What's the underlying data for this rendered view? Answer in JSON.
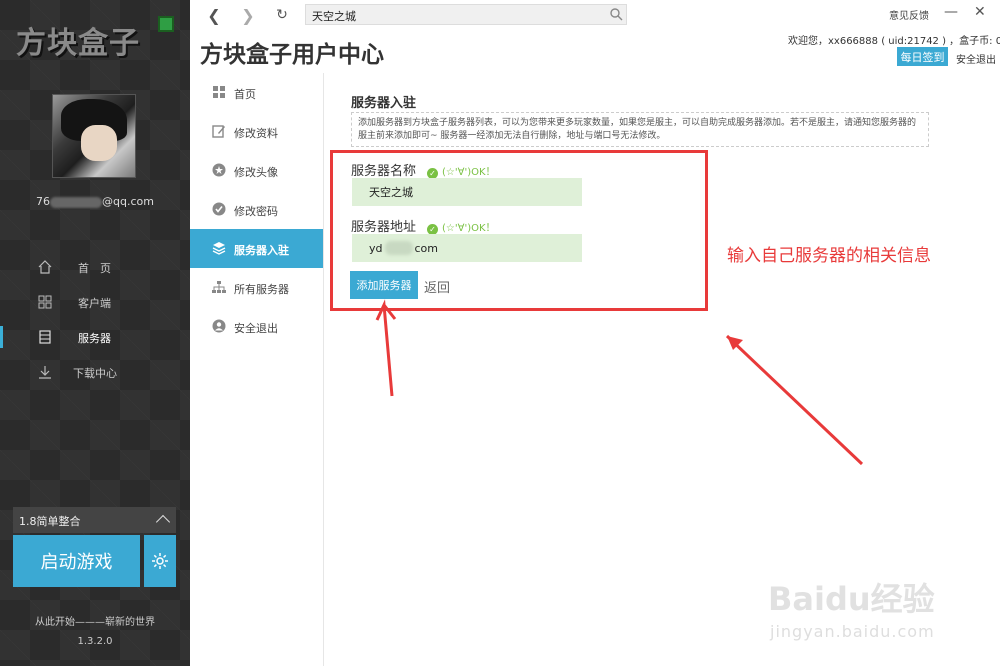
{
  "sidebar": {
    "logo": "方块盒子",
    "email_prefix": "76",
    "email_suffix": "@qq.com",
    "nav": [
      {
        "label": "首　页",
        "icon": "home-icon"
      },
      {
        "label": "客户端",
        "icon": "grid-icon"
      },
      {
        "label": "服务器",
        "icon": "server-icon"
      },
      {
        "label": "下载中心",
        "icon": "download-icon"
      }
    ],
    "version_select": "1.8简单整合",
    "launch_label": "启动游戏",
    "tagline": "从此开始———崭新的世界",
    "version": "1.3.2.0"
  },
  "topbar": {
    "address": "天空之城",
    "feedback": "意见反馈",
    "minimize": "—",
    "close": "✕"
  },
  "header": {
    "title": "方块盒子用户中心",
    "welcome": "欢迎您，xx666888 ( uid:21742 ) ，盒子币: 0",
    "signin": "每日签到",
    "logout": "安全退出"
  },
  "menu": [
    {
      "label": "首页",
      "icon": "home-icon"
    },
    {
      "label": "修改资料",
      "icon": "edit-icon"
    },
    {
      "label": "修改头像",
      "icon": "star-icon"
    },
    {
      "label": "修改密码",
      "icon": "check-icon"
    },
    {
      "label": "服务器入驻",
      "icon": "layers-icon"
    },
    {
      "label": "所有服务器",
      "icon": "sitemap-icon"
    },
    {
      "label": "安全退出",
      "icon": "user-icon"
    }
  ],
  "form": {
    "section_title": "服务器入驻",
    "description": "添加服务器到方块盒子服务器列表，可以为您带来更多玩家数量，如果您是服主，可以自助完成服务器添加。若不是服主，请通知您服务器的服主前来添加即可~ 服务器一经添加无法自行删除，地址与端口号无法修改。",
    "name_label": "服务器名称",
    "name_ok": "(☆'∀')OK！",
    "name_value": "天空之城",
    "addr_label": "服务器地址",
    "addr_ok": "(☆'∀')OK！",
    "addr_prefix": "yd",
    "addr_suffix": "com",
    "add_button": "添加服务器",
    "back": "返回"
  },
  "annotation": {
    "text": "输入自己服务器的相关信息",
    "color": "#e83a3a"
  },
  "watermark": {
    "main": "Baidu经验",
    "sub": "jingyan.baidu.com"
  },
  "colors": {
    "accent": "#3ba9d3",
    "ok_green": "#7ac143",
    "input_bg": "#dff0d8"
  }
}
